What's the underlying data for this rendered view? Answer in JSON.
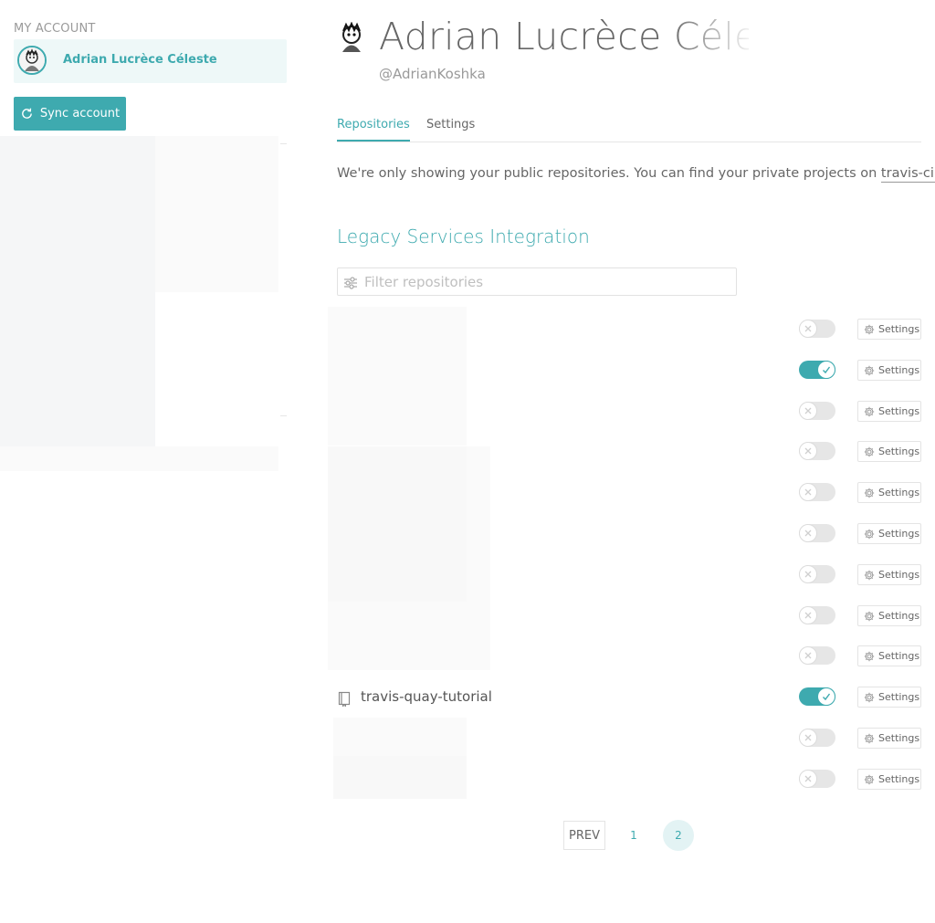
{
  "sidebar": {
    "section_title": "MY ACCOUNT",
    "account_name": "Adrian Lucrèce Céleste",
    "sync_label": "Sync account"
  },
  "profile": {
    "name": "Adrian Lucrèce Céleste",
    "handle": "@AdrianKoshka"
  },
  "tabs": [
    {
      "label": "Repositories",
      "active": true
    },
    {
      "label": "Settings",
      "active": false
    }
  ],
  "notice": {
    "text": "We're only showing your public repositories. You can find your private projects on ",
    "link": "travis-ci.com",
    "suffix": "."
  },
  "section_title": "Legacy Services Integration",
  "filter": {
    "placeholder": "Filter repositories",
    "value": ""
  },
  "repositories": [
    {
      "name": "",
      "enabled": false,
      "settings_label": "Settings"
    },
    {
      "name": "",
      "enabled": true,
      "settings_label": "Settings"
    },
    {
      "name": "",
      "enabled": false,
      "settings_label": "Settings"
    },
    {
      "name": "",
      "enabled": false,
      "settings_label": "Settings"
    },
    {
      "name": "",
      "enabled": false,
      "settings_label": "Settings"
    },
    {
      "name": "",
      "enabled": false,
      "settings_label": "Settings"
    },
    {
      "name": "",
      "enabled": false,
      "settings_label": "Settings"
    },
    {
      "name": "",
      "enabled": false,
      "settings_label": "Settings"
    },
    {
      "name": "",
      "enabled": false,
      "settings_label": "Settings"
    },
    {
      "name": "travis-quay-tutorial",
      "enabled": true,
      "settings_label": "Settings"
    },
    {
      "name": "",
      "enabled": false,
      "settings_label": "Settings"
    },
    {
      "name": "",
      "enabled": false,
      "settings_label": "Settings"
    }
  ],
  "pagination": {
    "prev_label": "PREV",
    "pages": [
      "1",
      "2"
    ],
    "current": "2"
  },
  "colors": {
    "accent": "#3eaaaf",
    "text": "#666666",
    "toggle_off": "#e6e6e6"
  },
  "icons": {
    "sync": "sync-icon",
    "filter": "filter-icon",
    "settings": "gear-icon",
    "repo": "repo-icon",
    "check": "check-icon",
    "close": "x-icon"
  }
}
